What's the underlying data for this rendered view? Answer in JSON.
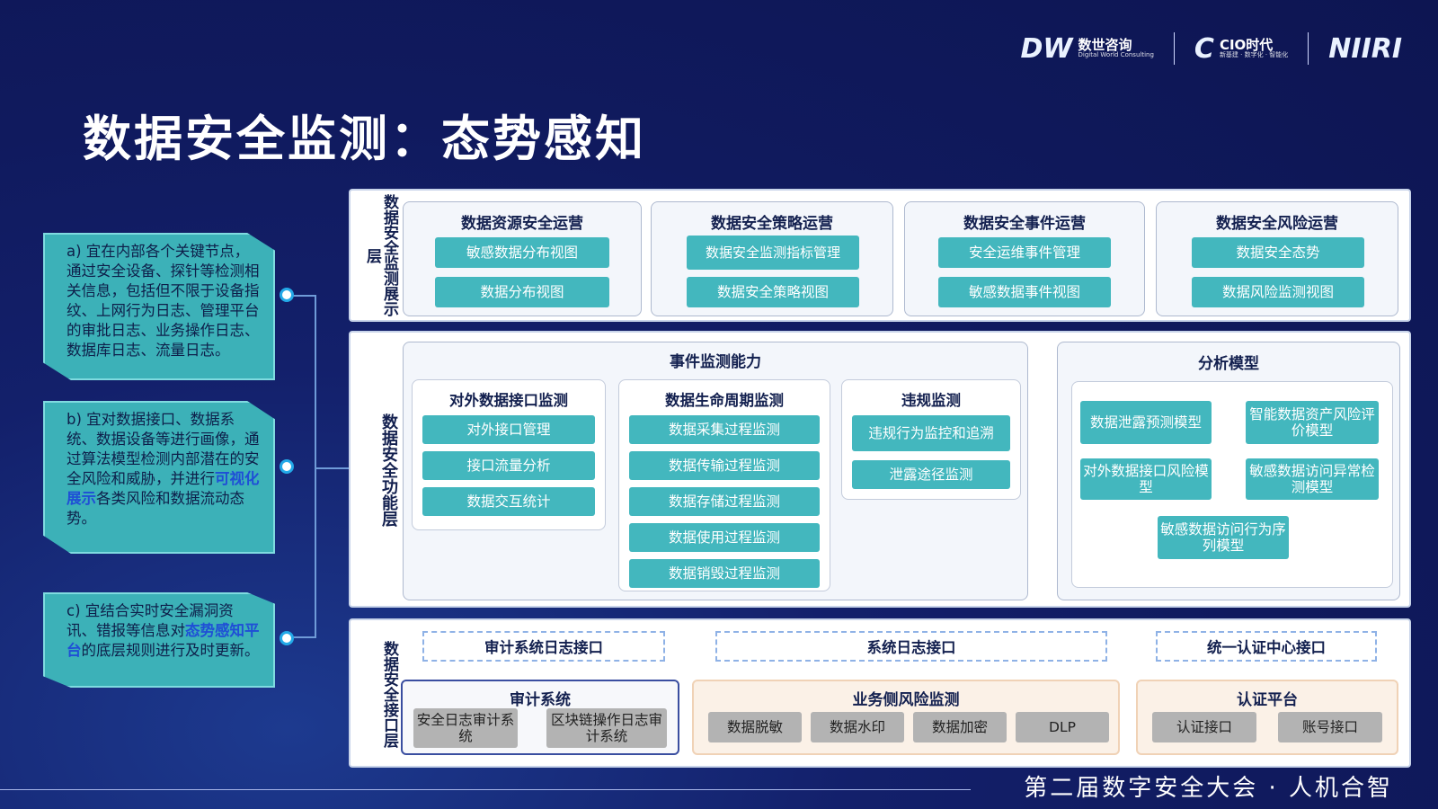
{
  "header": {
    "title": "数据安全监测：态势感知",
    "logos": [
      {
        "mark": "DW",
        "name": "数世咨询",
        "sub": "Digital World Consulting"
      },
      {
        "mark": "C",
        "name": "CIO时代",
        "sub": "新基建 · 数字化 · 智能化"
      },
      {
        "mark": "NIIRI",
        "name": "",
        "sub": ""
      }
    ]
  },
  "notes": [
    {
      "text": "a) 宜在内部各个关键节点，通过安全设备、探针等检测相关信息，包括但不限于设备指纹、上网行为日志、管理平台的审批日志、业务操作日志、数据库日志、流量日志。"
    },
    {
      "pre": "b) 宜对数据接口、数据系统、数据设备等进行画像，通过算法模型检测内部潜在的安全风险和威胁，并进行",
      "hl": "可视化展示",
      "post": "各类风险和数据流动态势。"
    },
    {
      "pre": "c) 宜结合实时安全漏洞资讯、错报等信息对",
      "hl": "态势感知平台",
      "post": "的底层规则进行及时更新。"
    }
  ],
  "display_layer": {
    "label": "数据安全监测展示层",
    "groups": [
      {
        "title": "数据资源安全运营",
        "items": [
          "敏感数据分布视图",
          "数据分布视图"
        ]
      },
      {
        "title": "数据安全策略运营",
        "items": [
          "数据安全监测指标管理",
          "数据安全策略视图"
        ]
      },
      {
        "title": "数据安全事件运营",
        "items": [
          "安全运维事件管理",
          "敏感数据事件视图"
        ]
      },
      {
        "title": "数据安全风险运营",
        "items": [
          "数据安全态势",
          "数据风险监测视图"
        ]
      }
    ]
  },
  "function_layer": {
    "label": "数据安全功能层",
    "event_title": "事件监测能力",
    "external": {
      "title": "对外数据接口监测",
      "items": [
        "对外接口管理",
        "接口流量分析",
        "数据交互统计"
      ]
    },
    "lifecycle": {
      "title": "数据生命周期监测",
      "items": [
        "数据采集过程监测",
        "数据传输过程监测",
        "数据存储过程监测",
        "数据使用过程监测",
        "数据销毁过程监测"
      ]
    },
    "violation": {
      "title": "违规监测",
      "items": [
        "违规行为监控和追溯",
        "泄露途径监测"
      ]
    },
    "analysis": {
      "title": "分析模型",
      "items": [
        "数据泄露预测模型",
        "智能数据资产风险评价模型",
        "对外数据接口风险模型",
        "敏感数据访问异常检测模型",
        "敏感数据访问行为序列模型"
      ]
    }
  },
  "interface_layer": {
    "label": "数据安全接口层",
    "interfaces": [
      "审计系统日志接口",
      "系统日志接口",
      "统一认证中心接口"
    ],
    "audit": {
      "title": "审计系统",
      "items": [
        "安全日志审计系统",
        "区块链操作日志审计系统"
      ]
    },
    "business": {
      "title": "业务侧风险监测",
      "items": [
        "数据脱敏",
        "数据水印",
        "数据加密",
        "DLP"
      ]
    },
    "auth": {
      "title": "认证平台",
      "items": [
        "认证接口",
        "账号接口"
      ]
    }
  },
  "footer": "第二届数字安全大会 · 人机合智"
}
